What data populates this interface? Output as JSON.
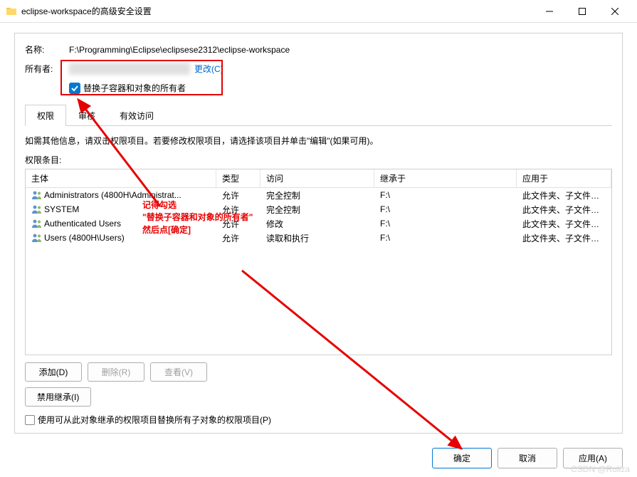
{
  "titlebar": {
    "title": "eclipse-workspace的高级安全设置"
  },
  "name_label": "名称:",
  "name_value": "F:\\Programming\\Eclipse\\eclipsese2312\\eclipse-workspace",
  "owner_label": "所有者:",
  "owner_value": "（已隐藏）",
  "change_link": "更改(C)",
  "replace_owner_cb": "替换子容器和对象的所有者",
  "tabs": {
    "perm": "权限",
    "audit": "审核",
    "effective": "有效访问"
  },
  "hint_text": "如需其他信息，请双击权限项目。若要修改权限项目，请选择该项目并单击\"编辑\"(如果可用)。",
  "entries_label": "权限条目:",
  "columns": {
    "principal": "主体",
    "type": "类型",
    "access": "访问",
    "inherited": "继承于",
    "applies": "应用于"
  },
  "rows": [
    {
      "principal": "Administrators (4800H\\Administrat...",
      "type": "允许",
      "access": "完全控制",
      "inherited": "F:\\",
      "applies": "此文件夹、子文件夹和文件"
    },
    {
      "principal": "SYSTEM",
      "type": "允许",
      "access": "完全控制",
      "inherited": "F:\\",
      "applies": "此文件夹、子文件夹和文件"
    },
    {
      "principal": "Authenticated Users",
      "type": "允许",
      "access": "修改",
      "inherited": "F:\\",
      "applies": "此文件夹、子文件夹和文件"
    },
    {
      "principal": "Users (4800H\\Users)",
      "type": "允许",
      "access": "读取和执行",
      "inherited": "F:\\",
      "applies": "此文件夹、子文件夹和文件"
    }
  ],
  "buttons": {
    "add": "添加(D)",
    "delete": "删除(R)",
    "view": "查看(V)",
    "disable_inherit": "禁用继承(I)"
  },
  "replace_child_cb": "使用可从此对象继承的权限项目替换所有子对象的权限项目(P)",
  "footer": {
    "ok": "确定",
    "cancel": "取消",
    "apply": "应用(A)"
  },
  "annotation": {
    "l1": "记得勾选",
    "l2": "\"替换子容器和对象的所有者\"",
    "l3": "然后点[确定]"
  },
  "watermark": "CSDN @Ruliza"
}
